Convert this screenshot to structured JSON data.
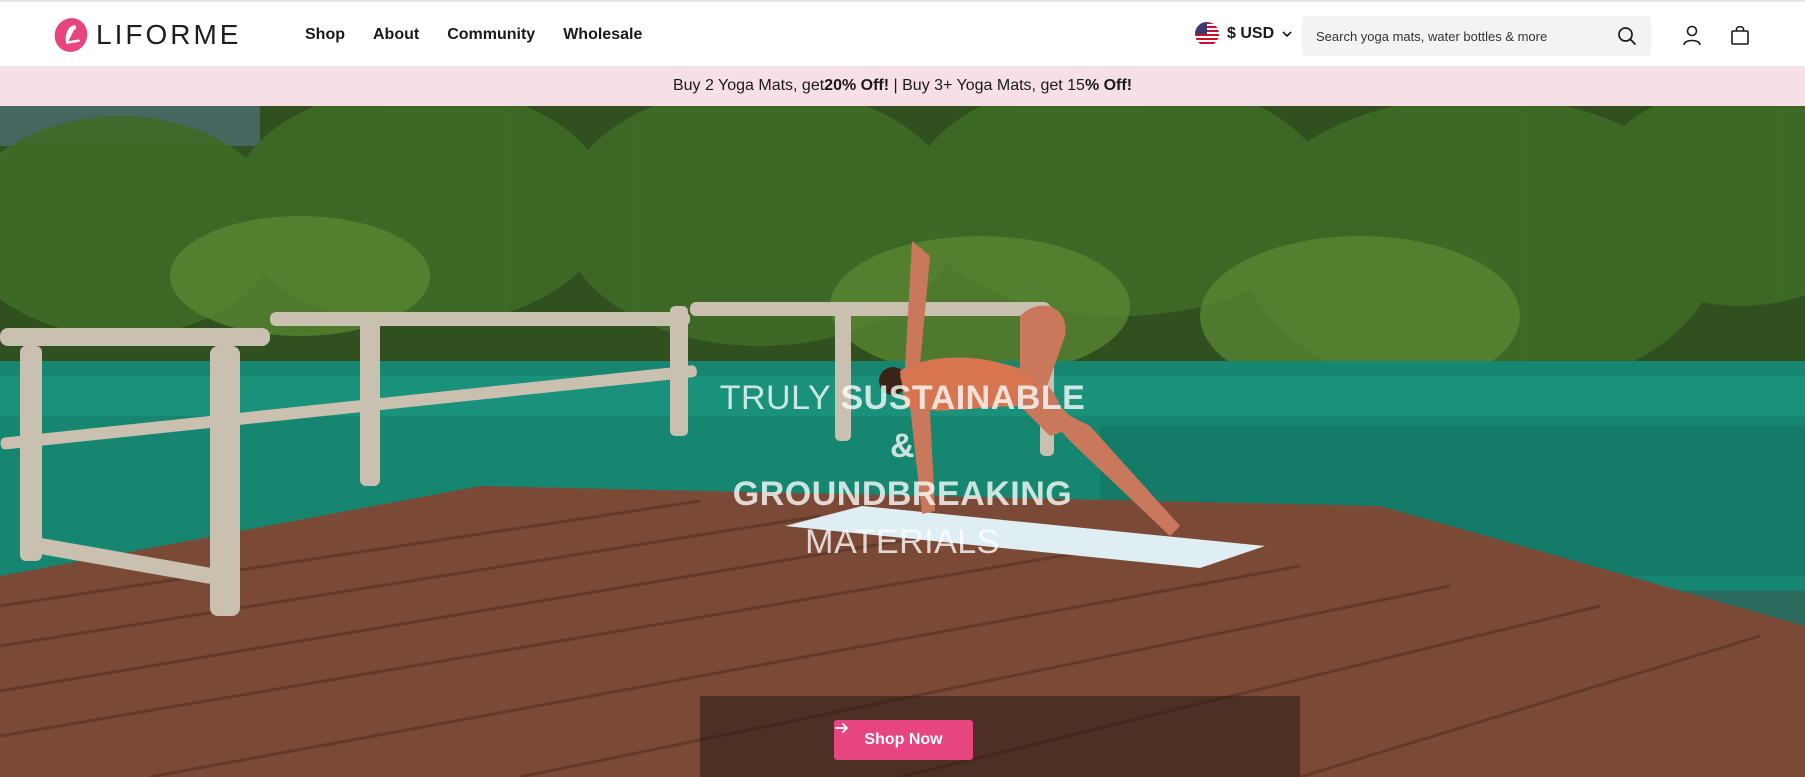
{
  "brand": {
    "name": "LIFORME",
    "logo_icon": "liforme-logo-icon"
  },
  "nav": {
    "items": [
      {
        "label": "Shop"
      },
      {
        "label": "About"
      },
      {
        "label": "Community"
      },
      {
        "label": "Wholesale"
      }
    ]
  },
  "header": {
    "currency_label": "$ USD",
    "search_placeholder": "Search yoga mats, water bottles & more"
  },
  "promo": {
    "part1": "Buy 2 Yoga Mats, get ",
    "part1_bold": "20% Off!",
    "separator": " | ",
    "part2": "Buy 3+ Yoga Mats, get 15",
    "part2_bold": "% Off!"
  },
  "hero": {
    "line1_a": "TRULY ",
    "line1_b": "SUSTAINABLE",
    "line2": "&",
    "line3": "GROUNDBREAKING",
    "line4": "MATERIALS",
    "cta_label": "Shop Now"
  },
  "colors": {
    "accent": "#e6457f",
    "promo_bg": "#f6dfe6"
  }
}
